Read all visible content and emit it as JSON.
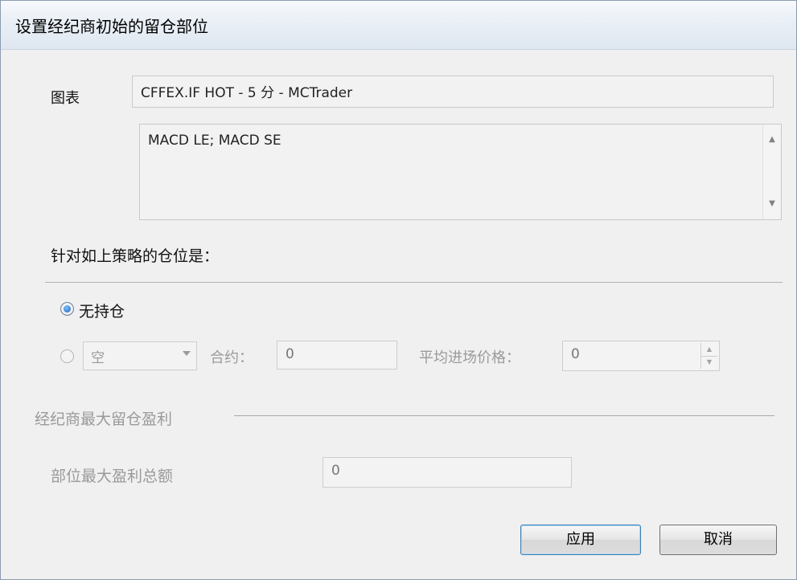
{
  "window": {
    "title": "设置经纪商初始的留仓部位"
  },
  "chart": {
    "label": "图表",
    "value": "CFFEX.IF HOT - 5 分 - MCTrader",
    "strategies": "MACD LE; MACD SE"
  },
  "position": {
    "heading": "针对如上策略的仓位是：",
    "no_position_label": "无持仓",
    "direction_value": "空",
    "contracts_label": "合约：",
    "contracts_value": "0",
    "avg_price_label": "平均进场价格：",
    "avg_price_value": "0"
  },
  "broker": {
    "section_title": "经纪商最大留仓盈利",
    "max_profit_label": "部位最大盈利总额",
    "max_profit_value": "0"
  },
  "buttons": {
    "apply": "应用",
    "cancel": "取消"
  }
}
